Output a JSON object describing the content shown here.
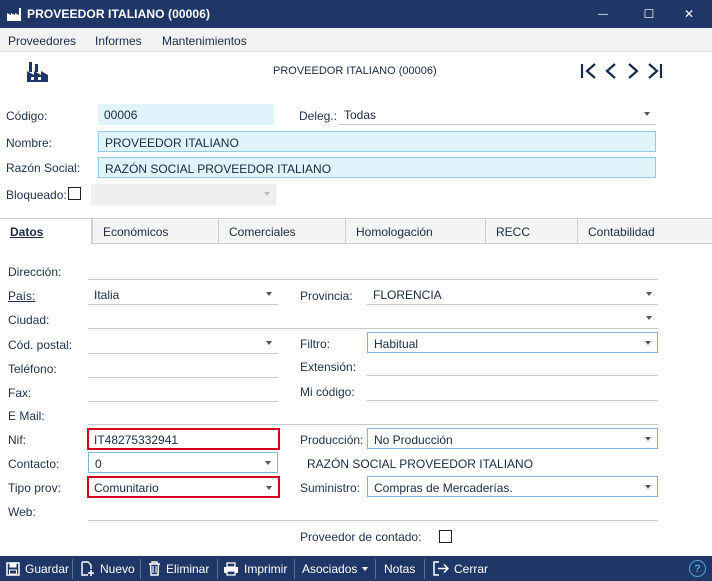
{
  "window": {
    "title": "PROVEEDOR ITALIANO (00006)",
    "minimize_glyph": "—",
    "maximize_glyph": "☐",
    "close_glyph": "✕"
  },
  "menu": {
    "items": [
      "Proveedores",
      "Informes",
      "Mantenimientos"
    ]
  },
  "header": {
    "record_title": "PROVEEDOR ITALIANO (00006)",
    "icon": "factory-icon",
    "nav_icons": [
      "first-record-icon",
      "previous-record-icon",
      "next-record-icon",
      "last-record-icon"
    ]
  },
  "form": {
    "codigo_label": "Código:",
    "codigo_value": "00006",
    "deleg_label": "Deleg.:",
    "deleg_value": "Todas",
    "nombre_label": "Nombre:",
    "nombre_value": "PROVEEDOR ITALIANO",
    "razon_label": "Razón Social:",
    "razon_value": "RAZÓN SOCIAL PROVEEDOR ITALIANO",
    "bloqueado_label": "Bloqueado:",
    "bloqueado_checked": false
  },
  "tabs": [
    {
      "label": "Datos",
      "active": true
    },
    {
      "label": "Económicos",
      "active": false
    },
    {
      "label": "Comerciales",
      "active": false
    },
    {
      "label": "Homologación",
      "active": false
    },
    {
      "label": "RECC",
      "active": false
    },
    {
      "label": "Contabilidad",
      "active": false
    }
  ],
  "datos": {
    "direccion_label": "Dirección:",
    "direccion_value": "",
    "pais_label": "País:",
    "pais_value": "Italia",
    "provincia_label": "Provincia:",
    "provincia_value": "FLORENCIA",
    "ciudad_label": "Ciudad:",
    "ciudad_value": "",
    "cp_label": "Cód. postal:",
    "cp_value": "",
    "filtro_label": "Filtro:",
    "filtro_value": "Habitual",
    "telefono_label": "Teléfono:",
    "telefono_value": "",
    "extension_label": "Extensión:",
    "extension_value": "",
    "fax_label": "Fax:",
    "fax_value": "",
    "micodigo_label": "Mi código:",
    "micodigo_value": "",
    "email_label": "E Mail:",
    "email_value": "",
    "nif_label": "Nif:",
    "nif_value": "IT48275332941",
    "produccion_label": "Producción:",
    "produccion_value": "No Producción",
    "contacto_label": "Contacto:",
    "contacto_value": "0",
    "contacto_name": "RAZÓN SOCIAL PROVEEDOR ITALIANO",
    "tipoprov_label": "Tipo prov:",
    "tipoprov_value": "Comunitario",
    "suministro_label": "Suministro:",
    "suministro_value": "Compras de Mercaderías.",
    "web_label": "Web:",
    "web_value": "",
    "contado_label": "Proveedor de contado:",
    "contado_checked": false
  },
  "toolbar": {
    "guardar": "Guardar",
    "nuevo": "Nuevo",
    "eliminar": "Eliminar",
    "imprimir": "Imprimir",
    "asociados": "Asociados",
    "notas": "Notas",
    "cerrar": "Cerrar",
    "help_glyph": "?"
  },
  "colors": {
    "titlebar": "#1e3766",
    "highlight_border": "#d4001c",
    "cyan_fill": "#dff4fb"
  }
}
